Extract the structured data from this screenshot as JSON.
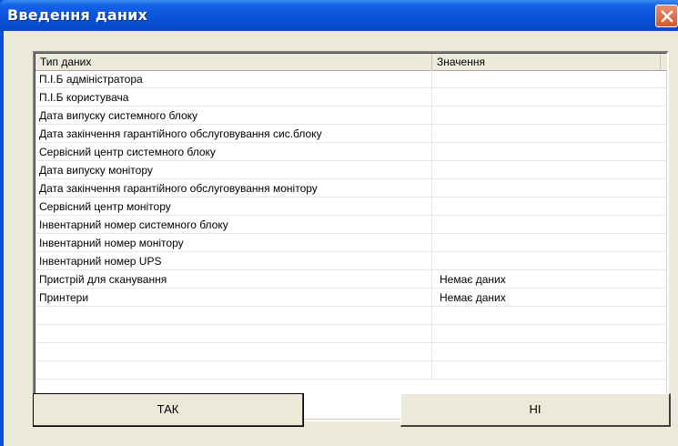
{
  "window": {
    "title": "Введення даних"
  },
  "grid": {
    "headers": [
      "Тип даних",
      "Значення"
    ],
    "rows": [
      {
        "type": "П.І.Б адміністратора",
        "value": ""
      },
      {
        "type": "П.І.Б користувача",
        "value": ""
      },
      {
        "type": "Дата випуску системного блоку",
        "value": ""
      },
      {
        "type": "Дата закінчення гарантійного обслуговування сис.блоку",
        "value": ""
      },
      {
        "type": "Сервісний центр системного блоку",
        "value": ""
      },
      {
        "type": "Дата випуску монітору",
        "value": ""
      },
      {
        "type": "Дата закінчення гарантійного обслуговування монітору",
        "value": ""
      },
      {
        "type": "Сервісний центр монітору",
        "value": ""
      },
      {
        "type": "Інвентарний номер системного блоку",
        "value": ""
      },
      {
        "type": "Інвентарний номер монітору",
        "value": ""
      },
      {
        "type": "Інвентарний номер UPS",
        "value": ""
      },
      {
        "type": "Пристрій для сканування",
        "value": "Немає даних"
      },
      {
        "type": "Принтери",
        "value": "Немає даних"
      },
      {
        "type": "",
        "value": ""
      },
      {
        "type": "",
        "value": ""
      },
      {
        "type": "",
        "value": ""
      },
      {
        "type": "",
        "value": ""
      }
    ]
  },
  "buttons": {
    "ok_label": "ТАК",
    "no_label": "НІ"
  },
  "icons": {
    "close": "close-icon"
  },
  "colors": {
    "titlebar": "#0a54db",
    "close_button": "#d9542b",
    "face": "#ece9d8"
  }
}
